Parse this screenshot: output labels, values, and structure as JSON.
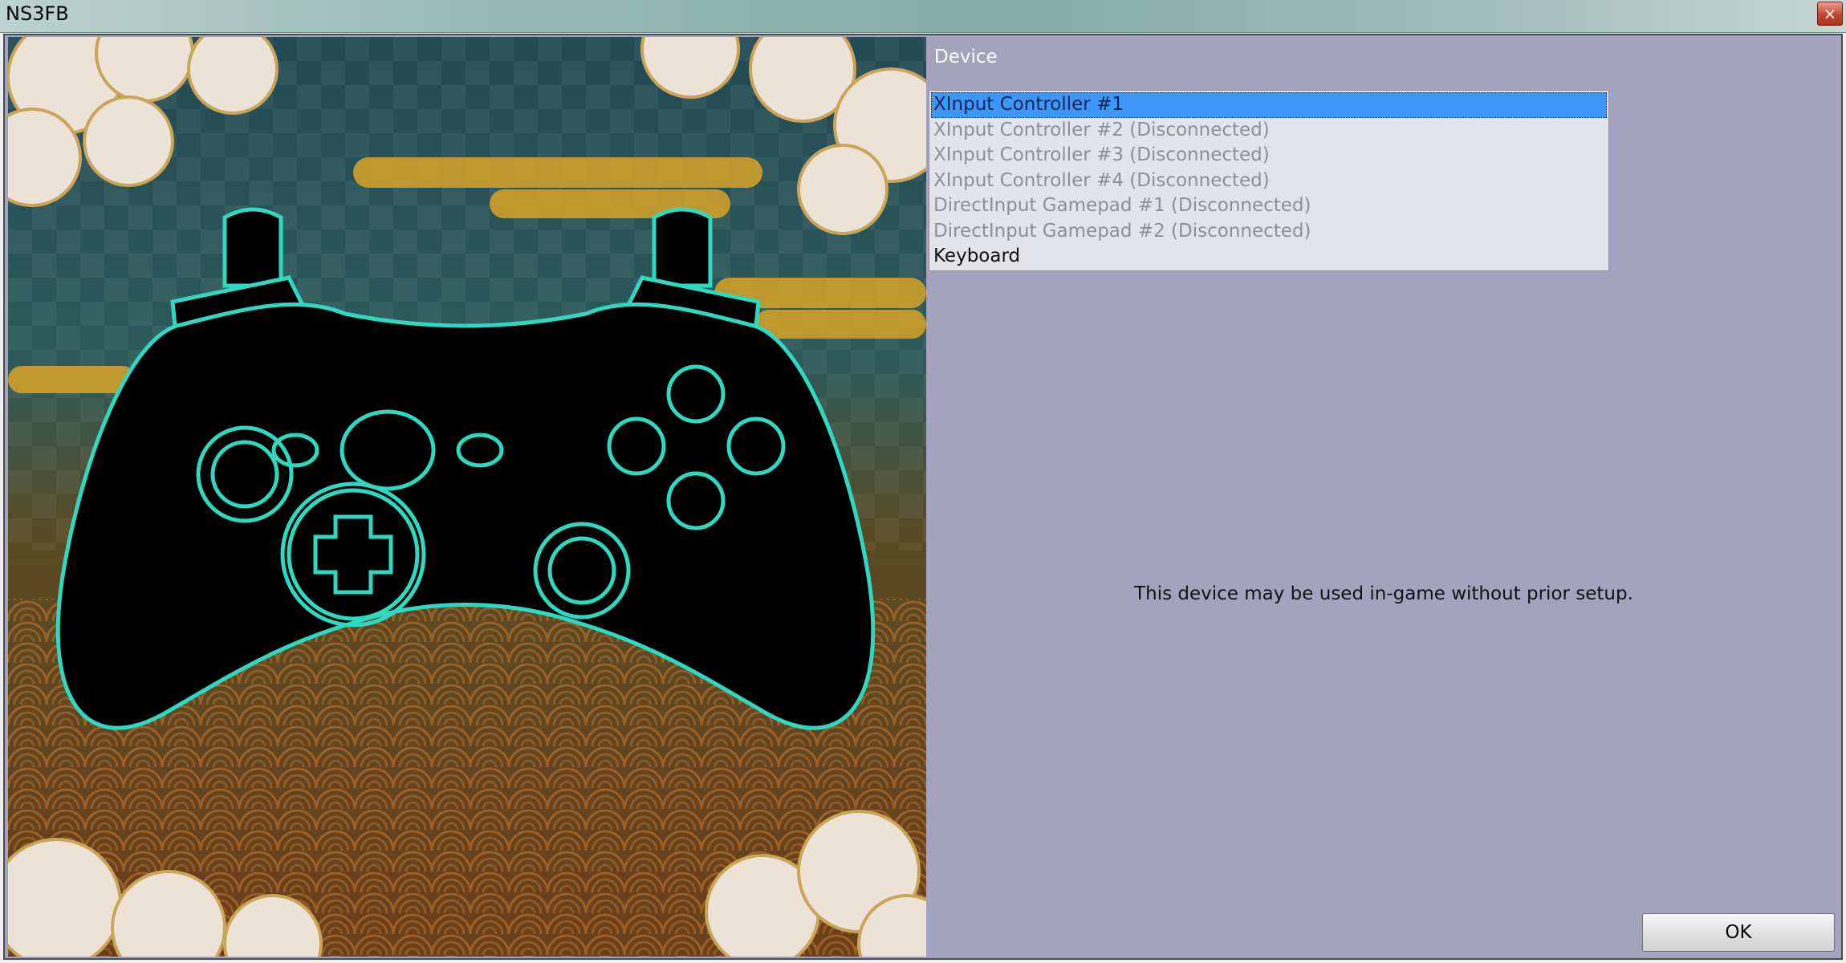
{
  "window": {
    "title": "NS3FB",
    "close_glyph": "×"
  },
  "device_section": {
    "label": "Device",
    "items": [
      {
        "label": "XInput Controller #1",
        "state": "selected"
      },
      {
        "label": "XInput Controller #2 (Disconnected)",
        "state": "disconnected"
      },
      {
        "label": "XInput Controller #3 (Disconnected)",
        "state": "disconnected"
      },
      {
        "label": "XInput Controller #4 (Disconnected)",
        "state": "disconnected"
      },
      {
        "label": "DirectInput Gamepad #1 (Disconnected)",
        "state": "disconnected"
      },
      {
        "label": "DirectInput Gamepad #2 (Disconnected)",
        "state": "disconnected"
      },
      {
        "label": "Keyboard",
        "state": "connected"
      }
    ]
  },
  "info_message": "This device may be used in-game without prior setup.",
  "buttons": {
    "ok_label": "OK"
  },
  "colors": {
    "panel_bg": "#a3a3bd",
    "list_bg": "#e3e3ea",
    "selection": "#3c97f6",
    "disconnected_text": "#8e8e98",
    "controller_outline": "#2fd8c0",
    "controller_fill": "#000000"
  },
  "icons": {
    "controller": "gamepad-outline-icon",
    "close": "close-icon"
  }
}
